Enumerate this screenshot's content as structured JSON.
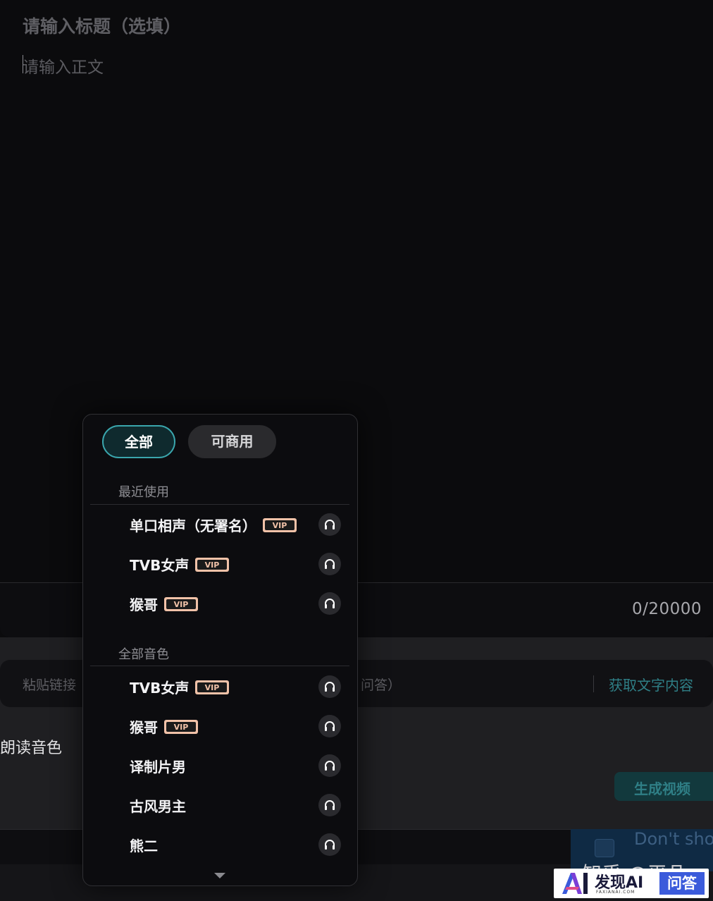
{
  "editor": {
    "title_placeholder": "请输入标题（选填）",
    "body_placeholder": "请输入正文"
  },
  "counter": {
    "text": "0/20000"
  },
  "link_bar": {
    "placeholder_start": "粘贴链接",
    "placeholder_end": "问答）",
    "fetch_label": "获取文字内容"
  },
  "voice_label": "朗读音色",
  "generate_label": "生成视频",
  "overlay": {
    "dont_show": "Don't sho",
    "zhihu": "知乎 @平凡"
  },
  "watermark": {
    "name": "发现AI",
    "domain": "FAXIANAI.COM",
    "qa": "问答"
  },
  "dropdown": {
    "filters": [
      {
        "label": "全部",
        "active": true
      },
      {
        "label": "可商用",
        "active": false
      }
    ],
    "recent_title": "最近使用",
    "recent": [
      {
        "name": "单口相声（无署名）",
        "vip": true
      },
      {
        "name": "TVB女声",
        "vip": true
      },
      {
        "name": "猴哥",
        "vip": true
      }
    ],
    "all_title": "全部音色",
    "all": [
      {
        "name": "TVB女声",
        "vip": true
      },
      {
        "name": "猴哥",
        "vip": true
      },
      {
        "name": "译制片男",
        "vip": false
      },
      {
        "name": "古风男主",
        "vip": false
      },
      {
        "name": "熊二",
        "vip": false
      }
    ]
  },
  "colors": {
    "accent": "#3aa6ad",
    "vip_badge": "#f1c2a8",
    "background": "#0b0b0d"
  }
}
